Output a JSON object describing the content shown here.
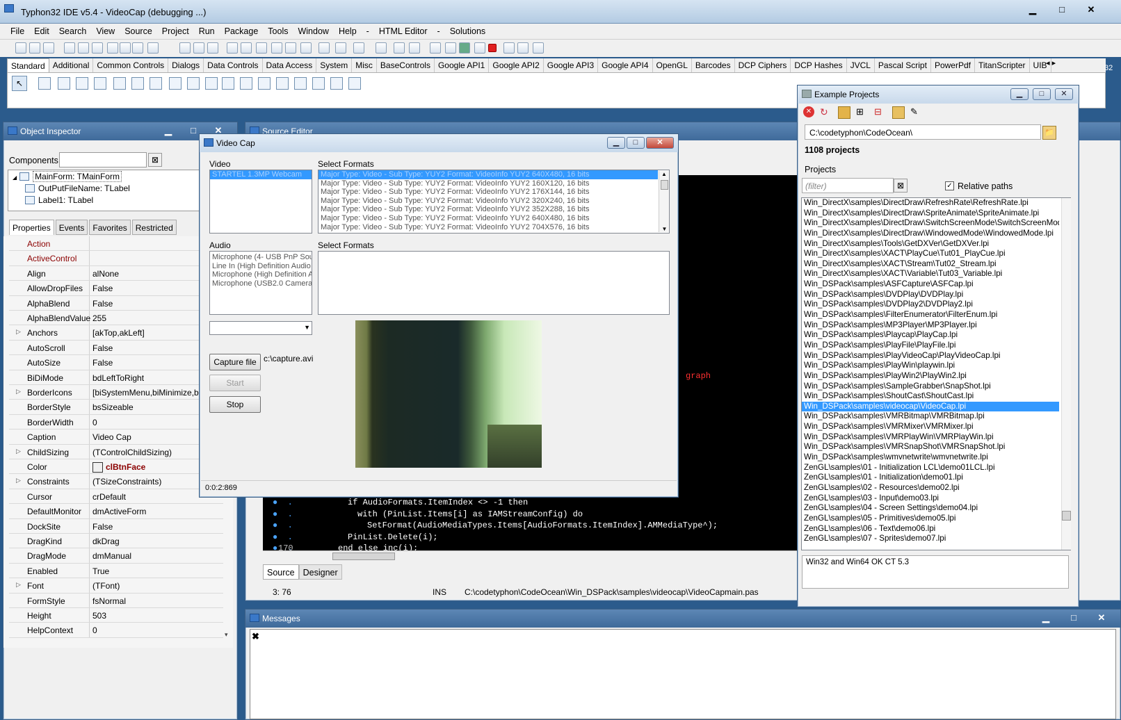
{
  "ide": {
    "title": "Typhon32 IDE v5.4 - VideoCap (debugging ...)",
    "menu": [
      "File",
      "Edit",
      "Search",
      "View",
      "Source",
      "Project",
      "Run",
      "Package",
      "Tools",
      "Window",
      "Help",
      "-",
      "HTML Editor",
      "-",
      "Solutions"
    ],
    "palette_tabs": [
      "Standard",
      "Additional",
      "Common Controls",
      "Dialogs",
      "Data Controls",
      "Data Access",
      "System",
      "Misc",
      "BaseControls",
      "Google API1",
      "Google API2",
      "Google API3",
      "Google API4",
      "OpenGL",
      "Barcodes",
      "DCP Ciphers",
      "DCP Hashes",
      "JVCL",
      "Pascal Script",
      "PowerPdf",
      "TitanScripter",
      "UIB"
    ],
    "palette_page_count": "32"
  },
  "object_inspector": {
    "title": "Object Inspector",
    "components_label": "Components",
    "tree": [
      "MainForm: TMainForm",
      "OutPutFileName: TLabel",
      "Label1: TLabel"
    ],
    "tabs": [
      "Properties",
      "Events",
      "Favorites",
      "Restricted"
    ],
    "properties": [
      {
        "name": "Action",
        "value": "",
        "expandable": false,
        "highlight": true
      },
      {
        "name": "ActiveControl",
        "value": "",
        "expandable": false,
        "highlight": true
      },
      {
        "name": "Align",
        "value": "alNone",
        "expandable": false
      },
      {
        "name": "AllowDropFiles",
        "value": "False",
        "expandable": false
      },
      {
        "name": "AlphaBlend",
        "value": "False",
        "expandable": false
      },
      {
        "name": "AlphaBlendValue",
        "value": "255",
        "expandable": false
      },
      {
        "name": "Anchors",
        "value": "[akTop,akLeft]",
        "expandable": true
      },
      {
        "name": "AutoScroll",
        "value": "False",
        "expandable": false
      },
      {
        "name": "AutoSize",
        "value": "False",
        "expandable": false
      },
      {
        "name": "BiDiMode",
        "value": "bdLeftToRight",
        "expandable": false
      },
      {
        "name": "BorderIcons",
        "value": "[biSystemMenu,biMinimize,bi",
        "expandable": true
      },
      {
        "name": "BorderStyle",
        "value": "bsSizeable",
        "expandable": false
      },
      {
        "name": "BorderWidth",
        "value": "0",
        "expandable": false
      },
      {
        "name": "Caption",
        "value": "Video Cap",
        "expandable": false
      },
      {
        "name": "ChildSizing",
        "value": "(TControlChildSizing)",
        "expandable": true
      },
      {
        "name": "Color",
        "value": "clBtnFace",
        "expandable": false,
        "color_value": true
      },
      {
        "name": "Constraints",
        "value": "(TSizeConstraints)",
        "expandable": true
      },
      {
        "name": "Cursor",
        "value": "crDefault",
        "expandable": false
      },
      {
        "name": "DefaultMonitor",
        "value": "dmActiveForm",
        "expandable": false
      },
      {
        "name": "DockSite",
        "value": "False",
        "expandable": false
      },
      {
        "name": "DragKind",
        "value": "dkDrag",
        "expandable": false
      },
      {
        "name": "DragMode",
        "value": "dmManual",
        "expandable": false
      },
      {
        "name": "Enabled",
        "value": "True",
        "expandable": false
      },
      {
        "name": "Font",
        "value": "(TFont)",
        "expandable": true
      },
      {
        "name": "FormStyle",
        "value": "fsNormal",
        "expandable": false
      },
      {
        "name": "Height",
        "value": "503",
        "expandable": false
      },
      {
        "name": "HelpContext",
        "value": "0",
        "expandable": false
      }
    ]
  },
  "source_editor": {
    "title": "Source Editor",
    "code_lines": [
      {
        "gutter": "",
        "text": "if AudioFormats.ItemIndex <> -1 then",
        "indent": 6
      },
      {
        "gutter": "",
        "text": "with (PinList.Items[i] as IAMStreamConfig) do",
        "indent": 7
      },
      {
        "gutter": "",
        "text": "SetFormat(AudioMediaTypes.Items[AudioFormats.ItemIndex].AMMediaType^);",
        "indent": 8
      },
      {
        "gutter": "",
        "text": "PinList.Delete(i);",
        "indent": 6
      },
      {
        "gutter": "170",
        "text": "end else inc(i);",
        "indent": 5
      }
    ],
    "partial_word": "graph",
    "tabs": [
      "Source",
      "Designer"
    ],
    "status": {
      "pos": "3: 76",
      "mode": "INS",
      "file": "C:\\codetyphon\\CodeOcean\\Win_DSPack\\samples\\videocap\\VideoCapmain.pas"
    }
  },
  "video_cap": {
    "title": "Video Cap",
    "video_label": "Video",
    "video_devices": [
      "STARTEL 1.3MP Webcam"
    ],
    "select_formats_label": "Select Formats",
    "video_formats": [
      "Major Type: Video - Sub Type: YUY2 Format: VideoInfo YUY2 640X480, 16 bits",
      "Major Type: Video - Sub Type: YUY2 Format: VideoInfo YUY2 160X120, 16 bits",
      "Major Type: Video - Sub Type: YUY2 Format: VideoInfo YUY2 176X144, 16 bits",
      "Major Type: Video - Sub Type: YUY2 Format: VideoInfo YUY2 320X240, 16 bits",
      "Major Type: Video - Sub Type: YUY2 Format: VideoInfo YUY2 352X288, 16 bits",
      "Major Type: Video - Sub Type: YUY2 Format: VideoInfo YUY2 640X480, 16 bits",
      "Major Type: Video - Sub Type: YUY2 Format: VideoInfo YUY2 704X576, 16 bits"
    ],
    "audio_label": "Audio",
    "audio_devices": [
      "Microphone (4- USB PnP Soun",
      "Line In (High Definition Audio",
      "Microphone (High Definition Au",
      "Microphone (USB2.0 Camera)"
    ],
    "audio_formats_label": "Select Formats",
    "capture_button": "Capture file",
    "capture_path": "c:\\capture.avi",
    "start_button": "Start",
    "stop_button": "Stop",
    "status_time": "0:0:2:869"
  },
  "example_projects": {
    "title": "Example Projects",
    "path": "C:\\codetyphon\\CodeOcean\\",
    "count": "1108 projects",
    "projects_label": "Projects",
    "filter_placeholder": "(filter)",
    "relative_paths_label": "Relative paths",
    "relative_paths_checked": true,
    "selected_index": 20,
    "items": [
      "Win_DirectX\\samples\\DirectDraw\\RefreshRate\\RefreshRate.lpi",
      "Win_DirectX\\samples\\DirectDraw\\SpriteAnimate\\SpriteAnimate.lpi",
      "Win_DirectX\\samples\\DirectDraw\\SwitchScreenMode\\SwitchScreenMode",
      "Win_DirectX\\samples\\DirectDraw\\WindowedMode\\WindowedMode.lpi",
      "Win_DirectX\\samples\\Tools\\GetDXVer\\GetDXVer.lpi",
      "Win_DirectX\\samples\\XACT\\PlayCue\\Tut01_PlayCue.lpi",
      "Win_DirectX\\samples\\XACT\\Stream\\Tut02_Stream.lpi",
      "Win_DirectX\\samples\\XACT\\Variable\\Tut03_Variable.lpi",
      "Win_DSPack\\samples\\ASFCapture\\ASFCap.lpi",
      "Win_DSPack\\samples\\DVDPlay\\DVDPlay.lpi",
      "Win_DSPack\\samples\\DVDPlay2\\DVDPlay2.lpi",
      "Win_DSPack\\samples\\FilterEnumerator\\FilterEnum.lpi",
      "Win_DSPack\\samples\\MP3Player\\MP3Player.lpi",
      "Win_DSPack\\samples\\Playcap\\PlayCap.lpi",
      "Win_DSPack\\samples\\PlayFile\\PlayFile.lpi",
      "Win_DSPack\\samples\\PlayVideoCap\\PlayVideoCap.lpi",
      "Win_DSPack\\samples\\PlayWin\\playwin.lpi",
      "Win_DSPack\\samples\\PlayWin2\\PlayWin2.lpi",
      "Win_DSPack\\samples\\SampleGrabber\\SnapShot.lpi",
      "Win_DSPack\\samples\\ShoutCast\\ShoutCast.lpi",
      "Win_DSPack\\samples\\videocap\\VideoCap.lpi",
      "Win_DSPack\\samples\\VMRBitmap\\VMRBitmap.lpi",
      "Win_DSPack\\samples\\VMRMixer\\VMRMixer.lpi",
      "Win_DSPack\\samples\\VMRPlayWin\\VMRPlayWin.lpi",
      "Win_DSPack\\samples\\VMRSnapShot\\VMRSnapShot.lpi",
      "Win_DSPack\\samples\\wmvnetwrite\\wmvnetwrite.lpi",
      "ZenGL\\samples\\01 - Initialization LCL\\demo01LCL.lpi",
      "ZenGL\\samples\\01 - Initialization\\demo01.lpi",
      "ZenGL\\samples\\02 - Resources\\demo02.lpi",
      "ZenGL\\samples\\03 - Input\\demo03.lpi",
      "ZenGL\\samples\\04 - Screen Settings\\demo04.lpi",
      "ZenGL\\samples\\05 - Primitives\\demo05.lpi",
      "ZenGL\\samples\\06 - Text\\demo06.lpi",
      "ZenGL\\samples\\07 - Sprites\\demo07.lpi"
    ],
    "description": "Win32 and Win64 OK CT 5.3"
  },
  "messages": {
    "title": "Messages"
  }
}
